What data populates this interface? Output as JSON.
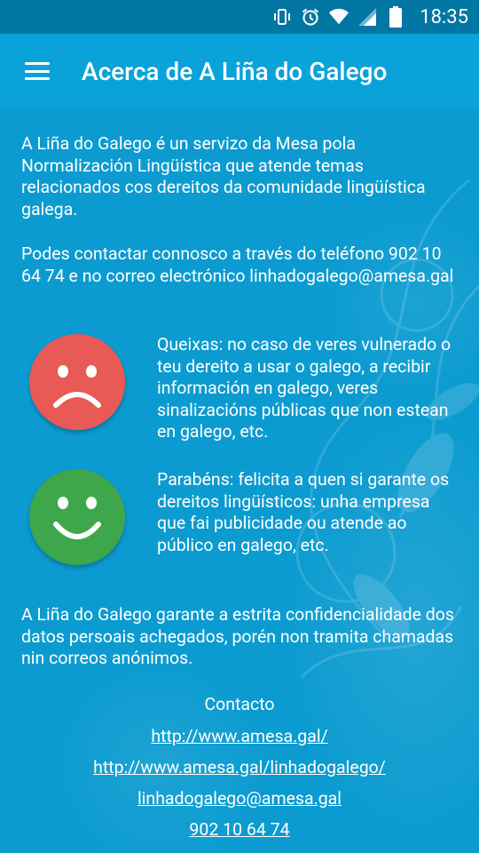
{
  "status_bar": {
    "time": "18:35",
    "icons": [
      "vibrate-icon",
      "alarm-icon",
      "wifi-icon",
      "signal-icon",
      "battery-icon"
    ]
  },
  "app_bar": {
    "title": "Acerca de A Liña do Galego",
    "menu_icon": "menu-icon"
  },
  "content": {
    "intro": "A Liña do Galego é un servizo da Mesa pola Normalización Lingüística que atende temas relacionados cos dereitos da comunidade lingüística galega.",
    "contact_info": "Podes contactar connosco a través do teléfono 902 10 64 74 e no correo electrónico linhadogalego@amesa.gal",
    "complaints": "Queixas: no caso de veres vulnerado o teu dereito a usar o galego, a recibir información en galego, veres sinalizacións públicas que non estean en galego, etc.",
    "congrats": "Parabéns: felicita a quen si garante os dereitos lingüísticos: unha empresa que fai publicidade ou atende ao público en galego, etc.",
    "privacy": "A Liña do Galego garante a estrita confidencialidade dos datos persoais achegados, porén non tramita chamadas nin correos anónimos."
  },
  "contact": {
    "heading": "Contacto",
    "links": [
      "http://www.amesa.gal/",
      "http://www.amesa.gal/linhadogalego/",
      "linhadogalego@amesa.gal",
      "902 10 64 74"
    ]
  },
  "colors": {
    "status_bar": "#0377a3",
    "app_bar": "#0aa3d9",
    "background": "#0b9bd0",
    "sad_face": "#e75a56",
    "happy_face": "#3ea74b"
  }
}
